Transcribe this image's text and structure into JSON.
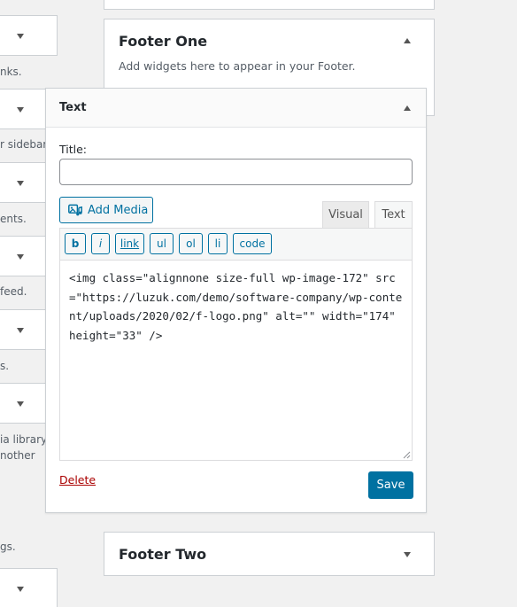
{
  "left_column": {
    "descriptions": [
      "nks.",
      "r sidebar.",
      "ents.",
      "feed.",
      "s.",
      "ia library",
      "nother",
      "gs."
    ]
  },
  "footer_one": {
    "title": "Footer One",
    "description": "Add widgets here to appear in your Footer."
  },
  "footer_two": {
    "title": "Footer Two"
  },
  "widget": {
    "title": "Text",
    "title_label": "Title:",
    "title_value": "",
    "add_media_label": "Add Media",
    "tabs": {
      "visual": "Visual",
      "text": "Text",
      "active": "Text"
    },
    "quicktags": [
      "b",
      "i",
      "link",
      "ul",
      "ol",
      "li",
      "code"
    ],
    "content": "<img class=\"alignnone size-full wp-image-172\" src=\"https://luzuk.com/demo/software-company/wp-content/uploads/2020/02/f-logo.png\" alt=\"\" width=\"174\" height=\"33\" />",
    "delete_label": "Delete",
    "save_label": "Save"
  },
  "colors": {
    "primary": "#0071a1",
    "delete": "#aa0000",
    "background": "#f1f1f1",
    "border": "#ccd0d4"
  }
}
